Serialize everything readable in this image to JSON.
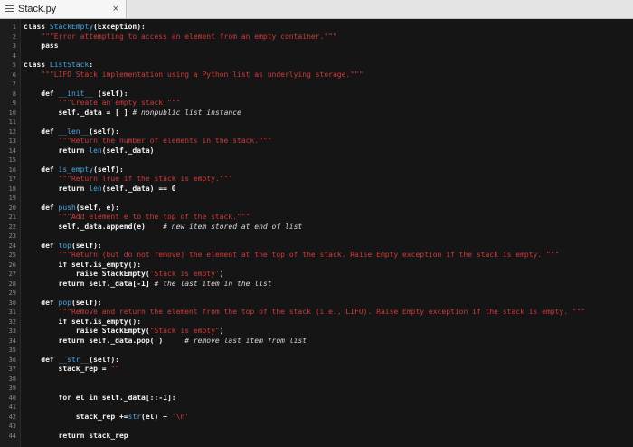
{
  "tab": {
    "title": "Stack.py",
    "close": "×"
  },
  "lines": [
    [
      [
        "kw",
        "class "
      ],
      [
        "fn",
        "StackEmpty"
      ],
      [
        "bold",
        "(Exception):"
      ]
    ],
    [
      [
        "plain",
        "    "
      ],
      [
        "str",
        "\"\"\"Error attempting to access an element from an empty container.\"\"\""
      ]
    ],
    [
      [
        "plain",
        "    "
      ],
      [
        "kw",
        "pass"
      ]
    ],
    [],
    [
      [
        "kw",
        "class "
      ],
      [
        "fn",
        "ListStack"
      ],
      [
        "bold",
        ":"
      ]
    ],
    [
      [
        "plain",
        "    "
      ],
      [
        "str",
        "\"\"\"LIFO Stack implementation using a Python list as underlying storage.\"\"\""
      ]
    ],
    [],
    [
      [
        "plain",
        "    "
      ],
      [
        "kw",
        "def "
      ],
      [
        "fn",
        "__init__"
      ],
      [
        "bold",
        " (self):"
      ]
    ],
    [
      [
        "plain",
        "        "
      ],
      [
        "str",
        "\"\"\"Create an empty stack.\"\"\""
      ]
    ],
    [
      [
        "plain",
        "        "
      ],
      [
        "bold",
        "self._data = [ ] "
      ],
      [
        "com",
        "# nonpublic list instance"
      ]
    ],
    [],
    [
      [
        "plain",
        "    "
      ],
      [
        "kw",
        "def "
      ],
      [
        "fn",
        "__len__"
      ],
      [
        "bold",
        "(self):"
      ]
    ],
    [
      [
        "plain",
        "        "
      ],
      [
        "str",
        "\"\"\"Return the number of elements in the stack.\"\"\""
      ]
    ],
    [
      [
        "plain",
        "        "
      ],
      [
        "kw",
        "return "
      ],
      [
        "fn",
        "len"
      ],
      [
        "bold",
        "(self._data)"
      ]
    ],
    [],
    [
      [
        "plain",
        "    "
      ],
      [
        "kw",
        "def "
      ],
      [
        "fn",
        "is_empty"
      ],
      [
        "bold",
        "(self):"
      ]
    ],
    [
      [
        "plain",
        "        "
      ],
      [
        "str",
        "\"\"\"Return True if the stack is empty.\"\"\""
      ]
    ],
    [
      [
        "plain",
        "        "
      ],
      [
        "kw",
        "return "
      ],
      [
        "fn",
        "len"
      ],
      [
        "bold",
        "(self._data) == 0"
      ]
    ],
    [],
    [
      [
        "plain",
        "    "
      ],
      [
        "kw",
        "def "
      ],
      [
        "fn",
        "push"
      ],
      [
        "bold",
        "(self, e):"
      ]
    ],
    [
      [
        "plain",
        "        "
      ],
      [
        "str",
        "\"\"\"Add element e to the top of the stack.\"\"\""
      ]
    ],
    [
      [
        "plain",
        "        "
      ],
      [
        "bold",
        "self._data.append(e)    "
      ],
      [
        "com",
        "# new item stored at end of list"
      ]
    ],
    [],
    [
      [
        "plain",
        "    "
      ],
      [
        "kw",
        "def "
      ],
      [
        "fn",
        "top"
      ],
      [
        "bold",
        "(self):"
      ]
    ],
    [
      [
        "plain",
        "        "
      ],
      [
        "str",
        "\"\"\"Return (but do not remove) the element at the top of the stack. Raise Empty exception if the stack is empty. \"\"\""
      ]
    ],
    [
      [
        "plain",
        "        "
      ],
      [
        "kw",
        "if "
      ],
      [
        "bold",
        "self.is_empty():"
      ]
    ],
    [
      [
        "plain",
        "            "
      ],
      [
        "kw",
        "raise "
      ],
      [
        "bold",
        "StackEmpty("
      ],
      [
        "str",
        "'Stack is empty'"
      ],
      [
        "bold",
        ")"
      ]
    ],
    [
      [
        "plain",
        "        "
      ],
      [
        "kw",
        "return "
      ],
      [
        "bold",
        "self._data[-1] "
      ],
      [
        "com",
        "# the last item in the list"
      ]
    ],
    [],
    [
      [
        "plain",
        "    "
      ],
      [
        "kw",
        "def "
      ],
      [
        "fn",
        "pop"
      ],
      [
        "bold",
        "(self):"
      ]
    ],
    [
      [
        "plain",
        "        "
      ],
      [
        "str",
        "\"\"\"Remove and return the element from the top of the stack (i.e., LIFO). Raise Empty exception if the stack is empty. \"\"\""
      ]
    ],
    [
      [
        "plain",
        "        "
      ],
      [
        "kw",
        "if "
      ],
      [
        "bold",
        "self.is_empty():"
      ]
    ],
    [
      [
        "plain",
        "            "
      ],
      [
        "kw",
        "raise "
      ],
      [
        "bold",
        "StackEmpty("
      ],
      [
        "str",
        "\"Stack is empty\""
      ],
      [
        "bold",
        ")"
      ]
    ],
    [
      [
        "plain",
        "        "
      ],
      [
        "kw",
        "return "
      ],
      [
        "bold",
        "self._data.pop( )     "
      ],
      [
        "com",
        "# remove last item from list"
      ]
    ],
    [],
    [
      [
        "plain",
        "    "
      ],
      [
        "kw",
        "def "
      ],
      [
        "fn",
        "__str__"
      ],
      [
        "bold",
        "(self):"
      ]
    ],
    [
      [
        "plain",
        "        "
      ],
      [
        "bold",
        "stack_rep = "
      ],
      [
        "str",
        "\"\""
      ]
    ],
    [],
    [],
    [
      [
        "plain",
        "        "
      ],
      [
        "kw",
        "for "
      ],
      [
        "bold",
        "el "
      ],
      [
        "kw",
        "in "
      ],
      [
        "bold",
        "self._data[::-1]:"
      ]
    ],
    [],
    [
      [
        "plain",
        "            "
      ],
      [
        "bold",
        "stack_rep +="
      ],
      [
        "fn",
        "str"
      ],
      [
        "bold",
        "(el) + "
      ],
      [
        "str",
        "'\\n'"
      ]
    ],
    [],
    [
      [
        "plain",
        "        "
      ],
      [
        "kw",
        "return "
      ],
      [
        "bold",
        "stack_rep"
      ]
    ]
  ]
}
